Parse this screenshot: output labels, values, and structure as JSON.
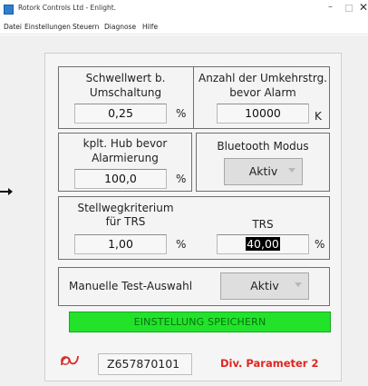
{
  "window": {
    "title": "Rotork Controls Ltd - Enlight.",
    "minimize_glyph": "–",
    "close_glyph": "✕"
  },
  "menubar": {
    "items": [
      "Datei",
      "Einstellungen",
      "Steuern",
      "Diagnose",
      "Hilfe"
    ]
  },
  "panel": {
    "schwellwert": {
      "label_line1": "Schwellwert b.",
      "label_line2": "Umschaltung",
      "value": "0,25",
      "unit": "%"
    },
    "umkehr": {
      "label_line1": "Anzahl der Umkehrstrg.",
      "label_line2": "bevor Alarm",
      "value": "10000",
      "unit": "K"
    },
    "hub": {
      "label_line1": "kplt. Hub bevor",
      "label_line2": "Alarmierung",
      "value": "100,0",
      "unit": "%"
    },
    "bluetooth": {
      "label": "Bluetooth Modus",
      "value": "Aktiv"
    },
    "stellweg": {
      "label_line1": "Stellwegkriterium",
      "label_line2": "für TRS",
      "value": "1,00",
      "unit": "%"
    },
    "trs": {
      "label": "TRS",
      "value": "40,00",
      "unit": "%"
    },
    "manuelle": {
      "label": "Manuelle Test-Auswahl",
      "value": "Aktiv"
    },
    "save_button_label": "EINSTELLUNG SPEICHERN",
    "serial_number": "Z657870101",
    "div_parameter_label": "Div. Parameter 2"
  },
  "colors": {
    "save_button": "#22e32a",
    "div_parameter": "#e0251f",
    "logo": "#d62a2a"
  }
}
